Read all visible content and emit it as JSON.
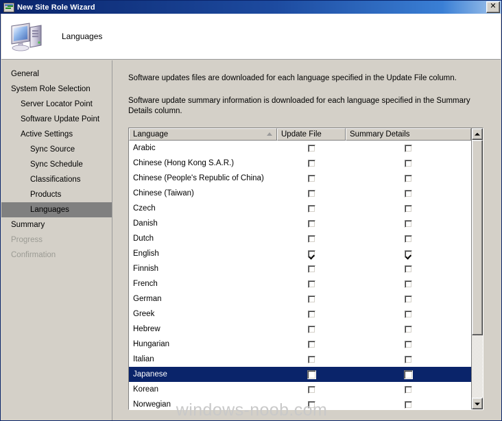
{
  "window": {
    "title": "New Site Role Wizard",
    "icon": "wizard-window-icon",
    "close_label": "✕"
  },
  "header": {
    "title": "Languages",
    "icon": "computer-icon"
  },
  "sidebar": {
    "items": [
      {
        "label": "General",
        "level": 0,
        "state": "normal"
      },
      {
        "label": "System Role Selection",
        "level": 0,
        "state": "normal"
      },
      {
        "label": "Server Locator Point",
        "level": 1,
        "state": "normal"
      },
      {
        "label": "Software Update Point",
        "level": 1,
        "state": "normal"
      },
      {
        "label": "Active Settings",
        "level": 1,
        "state": "normal"
      },
      {
        "label": "Sync Source",
        "level": 2,
        "state": "normal"
      },
      {
        "label": "Sync Schedule",
        "level": 2,
        "state": "normal"
      },
      {
        "label": "Classifications",
        "level": 2,
        "state": "normal"
      },
      {
        "label": "Products",
        "level": 2,
        "state": "normal"
      },
      {
        "label": "Languages",
        "level": 2,
        "state": "selected"
      },
      {
        "label": "Summary",
        "level": 0,
        "state": "normal"
      },
      {
        "label": "Progress",
        "level": 0,
        "state": "disabled"
      },
      {
        "label": "Confirmation",
        "level": 0,
        "state": "disabled"
      }
    ]
  },
  "content": {
    "description_1": "Software updates files are downloaded for each language specified in the  Update File column.",
    "description_2": "Software update summary information is downloaded for each language specified in the Summary Details column.",
    "table": {
      "columns": [
        {
          "label": "Language",
          "sorted": "ascending"
        },
        {
          "label": "Update File",
          "sorted": "none"
        },
        {
          "label": "Summary Details",
          "sorted": "none"
        }
      ],
      "rows": [
        {
          "language": "Arabic",
          "update_file": false,
          "summary_details": false,
          "selected": false
        },
        {
          "language": "Chinese (Hong Kong S.A.R.)",
          "update_file": false,
          "summary_details": false,
          "selected": false
        },
        {
          "language": "Chinese (People's Republic of China)",
          "update_file": false,
          "summary_details": false,
          "selected": false
        },
        {
          "language": "Chinese (Taiwan)",
          "update_file": false,
          "summary_details": false,
          "selected": false
        },
        {
          "language": "Czech",
          "update_file": false,
          "summary_details": false,
          "selected": false
        },
        {
          "language": "Danish",
          "update_file": false,
          "summary_details": false,
          "selected": false
        },
        {
          "language": "Dutch",
          "update_file": false,
          "summary_details": false,
          "selected": false
        },
        {
          "language": "English",
          "update_file": true,
          "summary_details": true,
          "selected": false
        },
        {
          "language": "Finnish",
          "update_file": false,
          "summary_details": false,
          "selected": false
        },
        {
          "language": "French",
          "update_file": false,
          "summary_details": false,
          "selected": false
        },
        {
          "language": "German",
          "update_file": false,
          "summary_details": false,
          "selected": false
        },
        {
          "language": "Greek",
          "update_file": false,
          "summary_details": false,
          "selected": false
        },
        {
          "language": "Hebrew",
          "update_file": false,
          "summary_details": false,
          "selected": false
        },
        {
          "language": "Hungarian",
          "update_file": false,
          "summary_details": false,
          "selected": false
        },
        {
          "language": "Italian",
          "update_file": false,
          "summary_details": false,
          "selected": false
        },
        {
          "language": "Japanese",
          "update_file": false,
          "summary_details": false,
          "selected": true
        },
        {
          "language": "Korean",
          "update_file": false,
          "summary_details": false,
          "selected": false
        },
        {
          "language": "Norwegian",
          "update_file": false,
          "summary_details": false,
          "selected": false
        }
      ]
    },
    "scrollbar": {
      "up_arrow": "▲",
      "down_arrow": "▼"
    }
  },
  "watermark": {
    "text": "windows-noob.com"
  },
  "colors": {
    "titlebar_start": "#0a246a",
    "titlebar_end": "#a8c8ec",
    "dialog_face": "#d4d0c8",
    "selection": "#0a246a",
    "nav_selected": "#808080",
    "disabled_text": "#9b9b94",
    "watermark": "#c9c9c9"
  }
}
